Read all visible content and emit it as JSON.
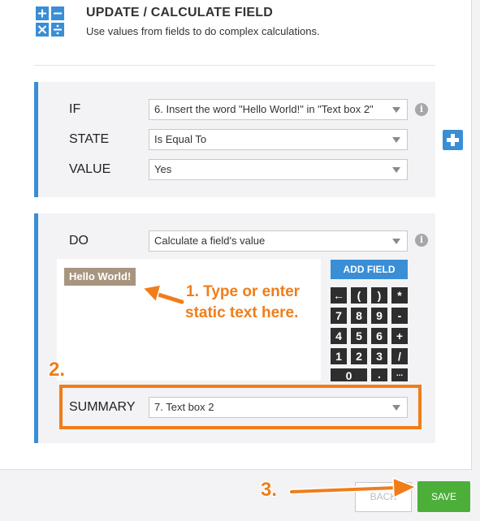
{
  "header": {
    "title": "UPDATE / CALCULATE FIELD",
    "subtitle": "Use values from fields to do complex calculations.",
    "icon": "calculator-icon"
  },
  "condition": {
    "if_label": "IF",
    "if_value": "6. Insert the word \"Hello World!\" in \"Text box 2\"",
    "state_label": "STATE",
    "state_value": "Is Equal To",
    "value_label": "VALUE",
    "value_value": "Yes"
  },
  "action": {
    "do_label": "DO",
    "do_value": "Calculate a field's value",
    "chip_text": "Hello World!",
    "add_field_label": "ADD FIELD",
    "keypad": [
      [
        "←",
        "(",
        ")",
        "*"
      ],
      [
        "7",
        "8",
        "9",
        "-"
      ],
      [
        "4",
        "5",
        "6",
        "+"
      ],
      [
        "1",
        "2",
        "3",
        "/"
      ],
      [
        "0",
        ".",
        "..."
      ]
    ],
    "summary_label": "SUMMARY",
    "summary_value": "7. Text box 2"
  },
  "annotations": {
    "step1_line1": "1. Type or enter",
    "step1_line2": "static text here.",
    "step2": "2.",
    "step3": "3."
  },
  "footer": {
    "back_label": "BACK",
    "save_label": "SAVE"
  },
  "colors": {
    "accent": "#3a8ed6",
    "annotation": "#f07d1a",
    "save": "#4caf3a",
    "chip": "#a89580"
  }
}
